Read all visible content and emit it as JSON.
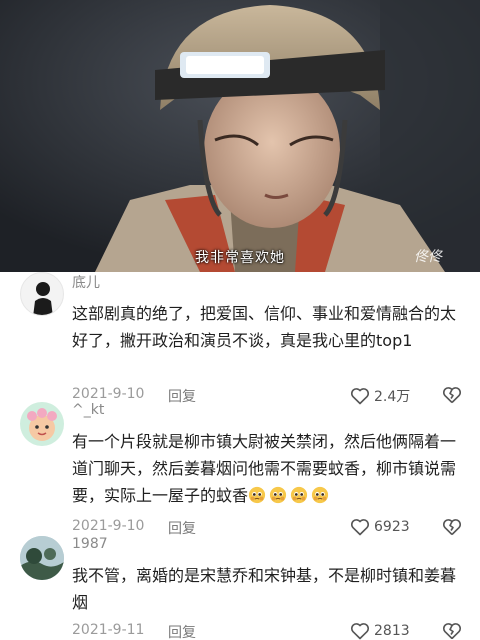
{
  "video": {
    "subtitle": "我非常喜欢她",
    "watermark": "佟佟"
  },
  "comments": [
    {
      "username": "底儿",
      "text": "这部剧真的绝了，把爱国、信仰、事业和爱情融合的太好了，撇开政治和演员不谈，真是我心里的top1",
      "date": "2021-9-10",
      "reply_label": "回复",
      "likes": "2.4万"
    },
    {
      "username": "^_kt",
      "text": "有一个片段就是柳市镇大尉被关禁闭，然后他俩隔着一道门聊天，然后姜暮烟问他需不需要蚊香，柳市镇说需要，实际上一屋子的蚊香",
      "emoji_count": 4,
      "date": "2021-9-10",
      "reply_label": "回复",
      "likes": "6923"
    },
    {
      "username": "1987",
      "text": "我不管，离婚的是宋慧乔和宋钟基，不是柳时镇和姜暮烟",
      "date": "2021-9-11",
      "reply_label": "回复",
      "likes": "2813"
    }
  ],
  "colors": {
    "meta_gray": "#9b9b9b",
    "username_gray": "#8a8a8a",
    "text": "#1f1f1f"
  }
}
